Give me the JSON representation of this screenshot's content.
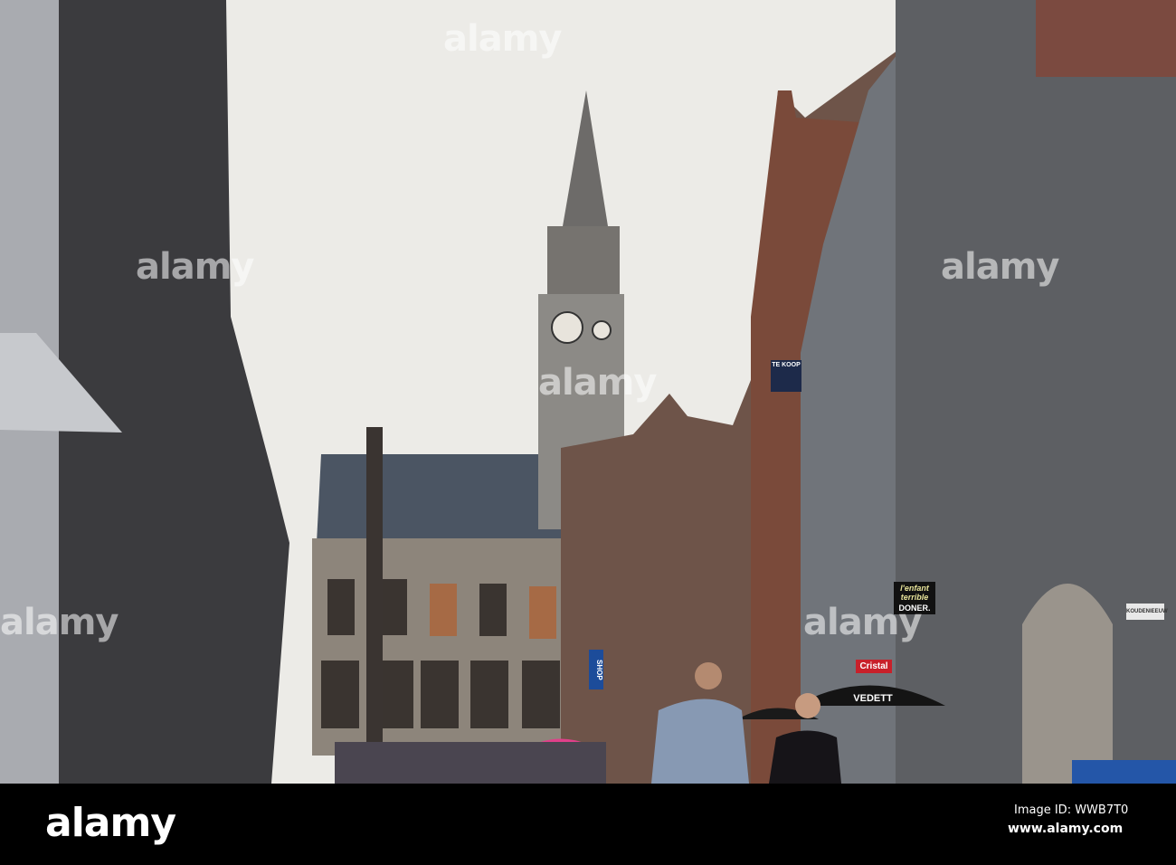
{
  "scene": {
    "description_colors": {
      "sky": "#ecebe7",
      "left_stone": "#3b3b3e",
      "right_stone": "#5d5f63",
      "brick": "#7a4a3a",
      "tower": "#8c8a86"
    },
    "signs": {
      "te_koop": "TE KOOP",
      "shop": "SHOP",
      "cristal": "Cristal",
      "vedett": "VEDETT",
      "enfant_terrible_line1": "l'enfant",
      "enfant_terrible_line2": "terrible",
      "doner": "DONER.",
      "street_name": "KOUDENIEEUW"
    }
  },
  "watermark": {
    "text": "alamy"
  },
  "bottom_bar": {
    "logo": "alamy",
    "image_id": "Image ID: WWB7T0",
    "url": "www.alamy.com"
  }
}
